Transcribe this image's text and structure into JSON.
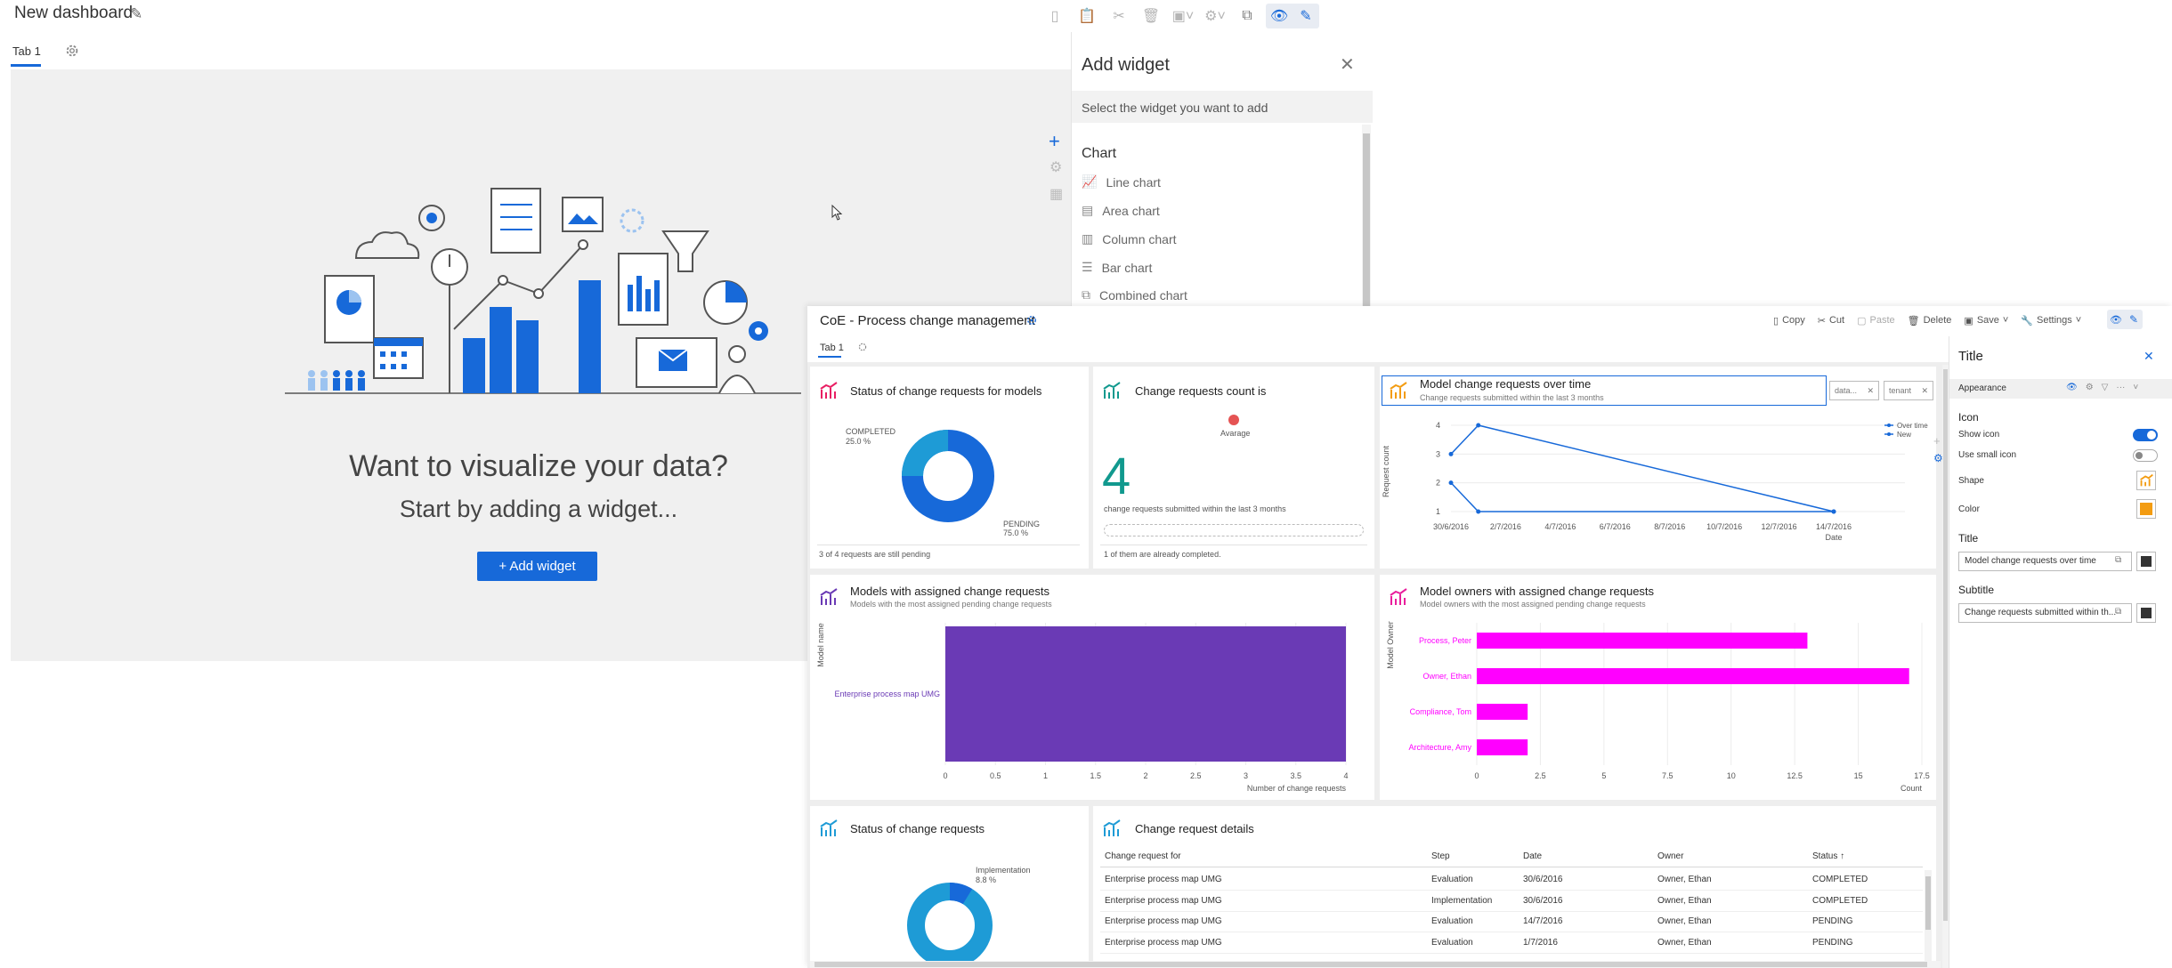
{
  "bg": {
    "title": "New dashboard",
    "tab": "Tab 1",
    "heading": "Want to visualize your data?",
    "subheading": "Start by adding a widget...",
    "add_widget_button": "+ Add widget"
  },
  "add_widget_panel": {
    "title": "Add widget",
    "close": "✕",
    "subtitle": "Select the widget you want to add",
    "section": "Chart",
    "items": [
      "Line chart",
      "Area chart",
      "Column chart",
      "Bar chart",
      "Combined chart"
    ]
  },
  "fg": {
    "title": "CoE - Process change management",
    "tab": "Tab 1",
    "toolbar": {
      "copy": "Copy",
      "cut": "Cut",
      "paste": "Paste",
      "delete": "Delete",
      "save": "Save",
      "settings": "Settings"
    }
  },
  "widgets": {
    "status_models": {
      "title": "Status of change requests for models",
      "footer": "3 of 4  requests are still pending",
      "chart_data": {
        "type": "pie",
        "categories": [
          "COMPLETED",
          "PENDING"
        ],
        "values": [
          25.0,
          75.0
        ],
        "labels": [
          "25.0 %",
          "75.0 %"
        ]
      }
    },
    "count": {
      "title": "Change requests count is",
      "legend": "Avarage",
      "value": "4",
      "caption": "change requests submitted within the last 3 months",
      "footer": "1 of them are already completed."
    },
    "over_time": {
      "title": "Model change requests over time",
      "subtitle": "Change requests submitted within the last 3 months",
      "filter1": "data...",
      "filter2": "tenant",
      "chart_data": {
        "type": "line",
        "x": [
          "30/6/2016",
          "1/7/2016",
          "14/7/2016"
        ],
        "xticks": [
          "30/6/2016",
          "2/7/2016",
          "4/7/2016",
          "6/7/2016",
          "8/7/2016",
          "10/7/2016",
          "12/7/2016",
          "14/7/2016"
        ],
        "yticks": [
          "1",
          "2",
          "3",
          "4"
        ],
        "xlabel": "Date",
        "ylabel": "Request count",
        "ylim": [
          1,
          4
        ],
        "series": [
          {
            "name": "Over time",
            "values": [
              3,
              4,
              1
            ]
          },
          {
            "name": "New",
            "values": [
              2,
              1,
              1
            ]
          }
        ]
      }
    },
    "models_assigned": {
      "title": "Models with assigned change requests",
      "subtitle": "Models with the most assigned pending change requests",
      "chart_data": {
        "type": "bar",
        "categories": [
          "Enterprise process map UMG"
        ],
        "values": [
          4
        ],
        "xticks": [
          "0",
          "0.5",
          "1",
          "1.5",
          "2",
          "2.5",
          "3",
          "3.5",
          "4"
        ],
        "xlim": [
          0,
          4
        ],
        "xlabel": "Number of change requests",
        "ylabel": "Model name"
      }
    },
    "owners_assigned": {
      "title": "Model owners with assigned change requests",
      "subtitle": "Model owners with the most assigned pending change requests",
      "chart_data": {
        "type": "bar",
        "categories": [
          "Process, Peter",
          "Owner, Ethan",
          "Compliance, Tom",
          "Architecture, Amy"
        ],
        "values": [
          13,
          17,
          2,
          2
        ],
        "xticks": [
          "0",
          "2.5",
          "5",
          "7.5",
          "10",
          "12.5",
          "15",
          "17.5"
        ],
        "xlim": [
          0,
          17.5
        ],
        "xlabel": "Count",
        "ylabel": "Model Owner"
      }
    },
    "status_requests": {
      "title": "Status of change requests",
      "chart_data": {
        "type": "pie",
        "categories": [
          "Implementation"
        ],
        "values": [
          8.8
        ],
        "labels": [
          "8.8 %"
        ]
      }
    },
    "details": {
      "title": "Change request details",
      "columns": [
        "Change request for",
        "Step",
        "Date",
        "Owner",
        "Status ↑"
      ],
      "rows": [
        [
          "Enterprise process map UMG",
          "Evaluation",
          "30/6/2016",
          "Owner, Ethan",
          "COMPLETED"
        ],
        [
          "Enterprise process map UMG",
          "Implementation",
          "30/6/2016",
          "Owner, Ethan",
          "COMPLETED"
        ],
        [
          "Enterprise process map UMG",
          "Evaluation",
          "14/7/2016",
          "Owner, Ethan",
          "PENDING"
        ],
        [
          "Enterprise process map UMG",
          "Evaluation",
          "1/7/2016",
          "Owner, Ethan",
          "PENDING"
        ]
      ]
    }
  },
  "props": {
    "title": "Title",
    "section": "Appearance",
    "icon_head": "Icon",
    "show_icon": "Show icon",
    "small_icon": "Use small icon",
    "shape": "Shape",
    "color": "Color",
    "title_head": "Title",
    "title_value": "Model change requests over time",
    "subtitle_head": "Subtitle",
    "subtitle_value": "Change requests submitted within th..."
  },
  "colors": {
    "primary": "#1769d9",
    "magenta": "#ff00ff",
    "purple": "#6a3ab5",
    "teal": "#11998e",
    "orange": "#f39c12"
  }
}
